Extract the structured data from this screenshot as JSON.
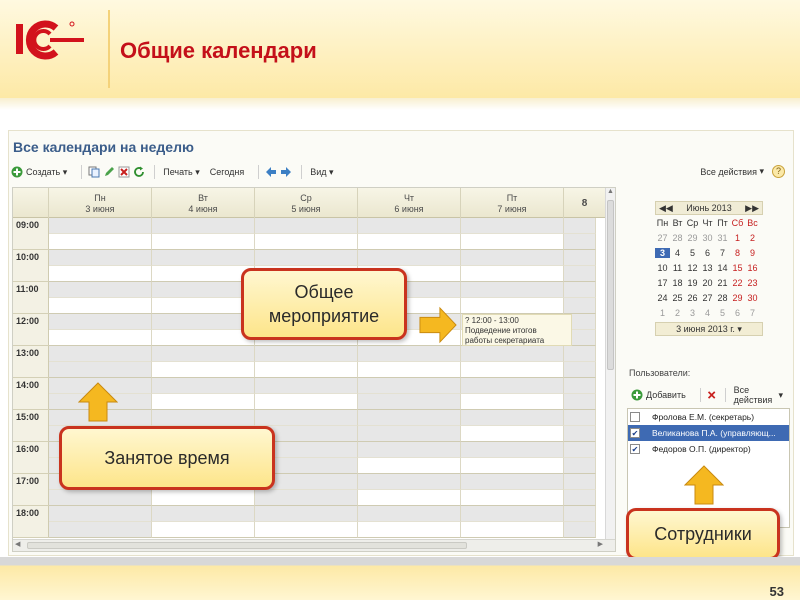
{
  "slide": {
    "title": "Общие календари",
    "page_number": "53"
  },
  "app": {
    "title": "Все календари на неделю",
    "toolbar": {
      "create": "Создать",
      "print": "Печать",
      "today": "Сегодня",
      "view": "Вид",
      "all_actions": "Все действия",
      "help": "?"
    },
    "days": [
      {
        "name": "Пн",
        "date": "3 июня"
      },
      {
        "name": "Вт",
        "date": "4 июня"
      },
      {
        "name": "Ср",
        "date": "5 июня"
      },
      {
        "name": "Чт",
        "date": "6 июня"
      },
      {
        "name": "Пт",
        "date": "7 июня"
      },
      {
        "name": "8",
        "date": ""
      }
    ],
    "times": [
      "09:00",
      "10:00",
      "11:00",
      "12:00",
      "13:00",
      "14:00",
      "15:00",
      "16:00",
      "17:00",
      "18:00"
    ],
    "event": {
      "line1": "? 12:00 - 13:00",
      "line2": "Подведение итогов",
      "line3": "работы секретариата"
    },
    "mini_calendar": {
      "month": "Июнь 2013",
      "weekdays": [
        "Пн",
        "Вт",
        "Ср",
        "Чт",
        "Пт",
        "Сб",
        "Вс"
      ],
      "weeks": [
        [
          "27",
          "28",
          "29",
          "30",
          "31",
          "1",
          "2"
        ],
        [
          "3",
          "4",
          "5",
          "6",
          "7",
          "8",
          "9"
        ],
        [
          "10",
          "11",
          "12",
          "13",
          "14",
          "15",
          "16"
        ],
        [
          "17",
          "18",
          "19",
          "20",
          "21",
          "22",
          "23"
        ],
        [
          "24",
          "25",
          "26",
          "27",
          "28",
          "29",
          "30"
        ],
        [
          "1",
          "2",
          "3",
          "4",
          "5",
          "6",
          "7"
        ]
      ],
      "footer": "3 июня 2013 г."
    },
    "users": {
      "label": "Пользователи:",
      "add": "Добавить",
      "all_actions": "Все действия",
      "items": [
        {
          "name": "Фролова Е.М. (секретарь)",
          "checked": false
        },
        {
          "name": "Великанова П.А. (управляющ...",
          "checked": true
        },
        {
          "name": "Федоров О.П. (директор)",
          "checked": true
        }
      ]
    }
  },
  "callouts": {
    "event": "Общее мероприятие",
    "busy": "Занятое время",
    "staff": "Сотрудники"
  },
  "colors": {
    "accent_red": "#c4101a",
    "selection_blue": "#3e6ab3",
    "callout_border": "#c9331e",
    "arrow_fill": "#f5b820"
  }
}
